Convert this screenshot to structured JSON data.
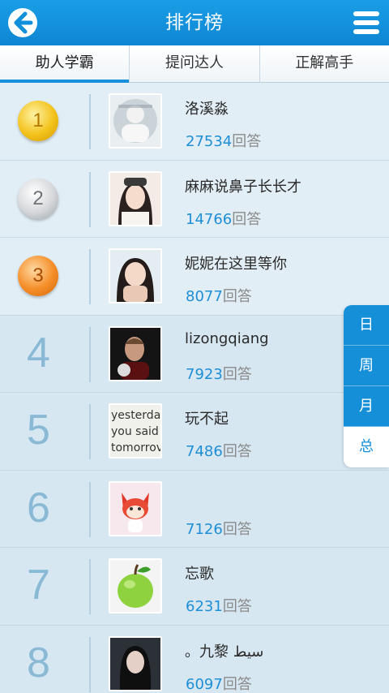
{
  "header": {
    "title": "排行榜"
  },
  "tabs": [
    {
      "label": "助人学霸",
      "active": true
    },
    {
      "label": "提问达人",
      "active": false
    },
    {
      "label": "正解高手",
      "active": false
    }
  ],
  "answer_label": "回答",
  "ranking": [
    {
      "rank": "1",
      "name": "洛溪淼",
      "count": "27534",
      "medal": "gold"
    },
    {
      "rank": "2",
      "name": "麻麻说鼻子长长才",
      "count": "14766",
      "medal": "silver"
    },
    {
      "rank": "3",
      "name": "妮妮在这里等你",
      "count": "8077",
      "medal": "bronze"
    },
    {
      "rank": "4",
      "name": "lizongqiang",
      "count": "7923"
    },
    {
      "rank": "5",
      "name": "玩不起",
      "count": "7486"
    },
    {
      "rank": "6",
      "name": "",
      "count": "7126"
    },
    {
      "rank": "7",
      "name": "忘歌",
      "count": "6231"
    },
    {
      "rank": "8",
      "name": "。九黎 سيط",
      "count": "6097"
    }
  ],
  "avatar_5_text": [
    "yesterda",
    "you said",
    "tomorrov"
  ],
  "time_range": [
    {
      "label": "日",
      "selected": false
    },
    {
      "label": "周",
      "selected": false
    },
    {
      "label": "月",
      "selected": false
    },
    {
      "label": "总",
      "selected": true
    }
  ],
  "colors": {
    "accent": "#1590d8",
    "count": "#1e8fd6",
    "header": "#0f86d3"
  }
}
